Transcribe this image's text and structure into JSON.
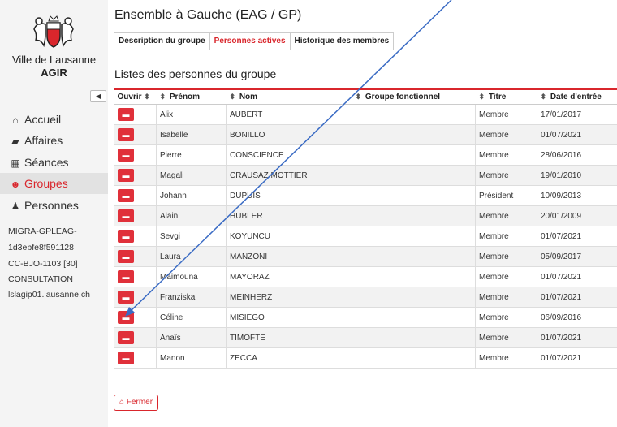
{
  "sidebar": {
    "city": "Ville de Lausanne",
    "app": "AGIR",
    "nav": [
      {
        "icon": "home-icon",
        "glyph": "⌂",
        "label": "Accueil"
      },
      {
        "icon": "briefcase-icon",
        "glyph": "▰",
        "label": "Affaires"
      },
      {
        "icon": "calendar-icon",
        "glyph": "▦",
        "label": "Séances"
      },
      {
        "icon": "users-icon",
        "glyph": "☻",
        "label": "Groupes"
      },
      {
        "icon": "user-icon",
        "glyph": "♟",
        "label": "Personnes"
      }
    ],
    "info": [
      "MIGRA-GPLEAG-",
      "1d3ebfe8f591128",
      "CC-BJO-1103 [30]",
      "CONSULTATION",
      "lslagip01.lausanne.ch"
    ]
  },
  "main": {
    "title": "Ensemble à Gauche (EAG / GP)",
    "tabs": [
      "Description du groupe",
      "Personnes actives",
      "Historique des membres"
    ],
    "section_title": "Listes des personnes du groupe",
    "columns": [
      "Ouvrir",
      "Prénom",
      "Nom",
      "Groupe fonctionnel",
      "Titre",
      "Date d'entrée"
    ],
    "rows": [
      {
        "prenom": "Alix",
        "nom": "AUBERT",
        "groupe": "",
        "titre": "Membre",
        "date": "17/01/2017"
      },
      {
        "prenom": "Isabelle",
        "nom": "BONILLO",
        "groupe": "",
        "titre": "Membre",
        "date": "01/07/2021"
      },
      {
        "prenom": "Pierre",
        "nom": "CONSCIENCE",
        "groupe": "",
        "titre": "Membre",
        "date": "28/06/2016"
      },
      {
        "prenom": "Magali",
        "nom": "CRAUSAZ MOTTIER",
        "groupe": "",
        "titre": "Membre",
        "date": "19/01/2010"
      },
      {
        "prenom": "Johann",
        "nom": "DUPUIS",
        "groupe": "",
        "titre": "Président",
        "date": "10/09/2013"
      },
      {
        "prenom": "Alain",
        "nom": "HUBLER",
        "groupe": "",
        "titre": "Membre",
        "date": "20/01/2009"
      },
      {
        "prenom": "Sevgi",
        "nom": "KOYUNCU",
        "groupe": "",
        "titre": "Membre",
        "date": "01/07/2021"
      },
      {
        "prenom": "Laura",
        "nom": "MANZONI",
        "groupe": "",
        "titre": "Membre",
        "date": "05/09/2017"
      },
      {
        "prenom": "Maimouna",
        "nom": "MAYORAZ",
        "groupe": "",
        "titre": "Membre",
        "date": "01/07/2021"
      },
      {
        "prenom": "Franziska",
        "nom": "MEINHERZ",
        "groupe": "",
        "titre": "Membre",
        "date": "01/07/2021"
      },
      {
        "prenom": "Céline",
        "nom": "MISIEGO",
        "groupe": "",
        "titre": "Membre",
        "date": "06/09/2016"
      },
      {
        "prenom": "Anaïs",
        "nom": "TIMOFTE",
        "groupe": "",
        "titre": "Membre",
        "date": "01/07/2021"
      },
      {
        "prenom": "Manon",
        "nom": "ZECCA",
        "groupe": "",
        "titre": "Membre",
        "date": "01/07/2021"
      }
    ],
    "close_label": "Fermer"
  },
  "colors": {
    "accent": "#d9262c",
    "button": "#e0303a",
    "arrow": "#3a6bc4"
  }
}
